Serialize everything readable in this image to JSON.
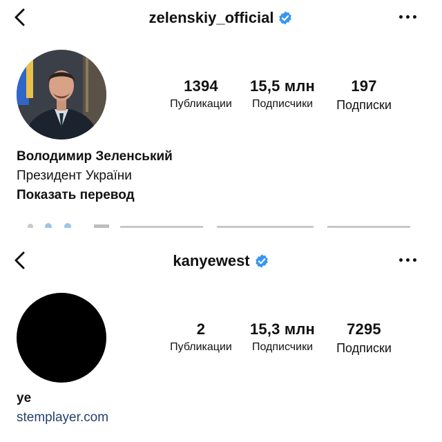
{
  "profiles": [
    {
      "username": "zelenskiy_official",
      "stats": [
        {
          "value": "1394",
          "label": "Публикации"
        },
        {
          "value": "15,5 млн",
          "label": "Подписчики"
        },
        {
          "value": "197",
          "label": "Подписки"
        }
      ],
      "bio": {
        "name": "Володимир Зеленський",
        "title": "Президент України",
        "translate": "Показать перевод"
      }
    },
    {
      "username": "kanyewest",
      "stats": [
        {
          "value": "2",
          "label": "Публикации"
        },
        {
          "value": "15,3 млн",
          "label": "Подписчики"
        },
        {
          "value": "7295",
          "label": "Подписки"
        }
      ],
      "bio": {
        "name": "ye",
        "link": "stemplayer.com"
      }
    }
  ],
  "icons": {
    "back": "chevron-left-icon",
    "verified": "verified-badge-icon",
    "more": "more-horizontal-icon"
  },
  "colors": {
    "verified": "#3797f0",
    "link": "#24426c",
    "text": "#111111"
  }
}
